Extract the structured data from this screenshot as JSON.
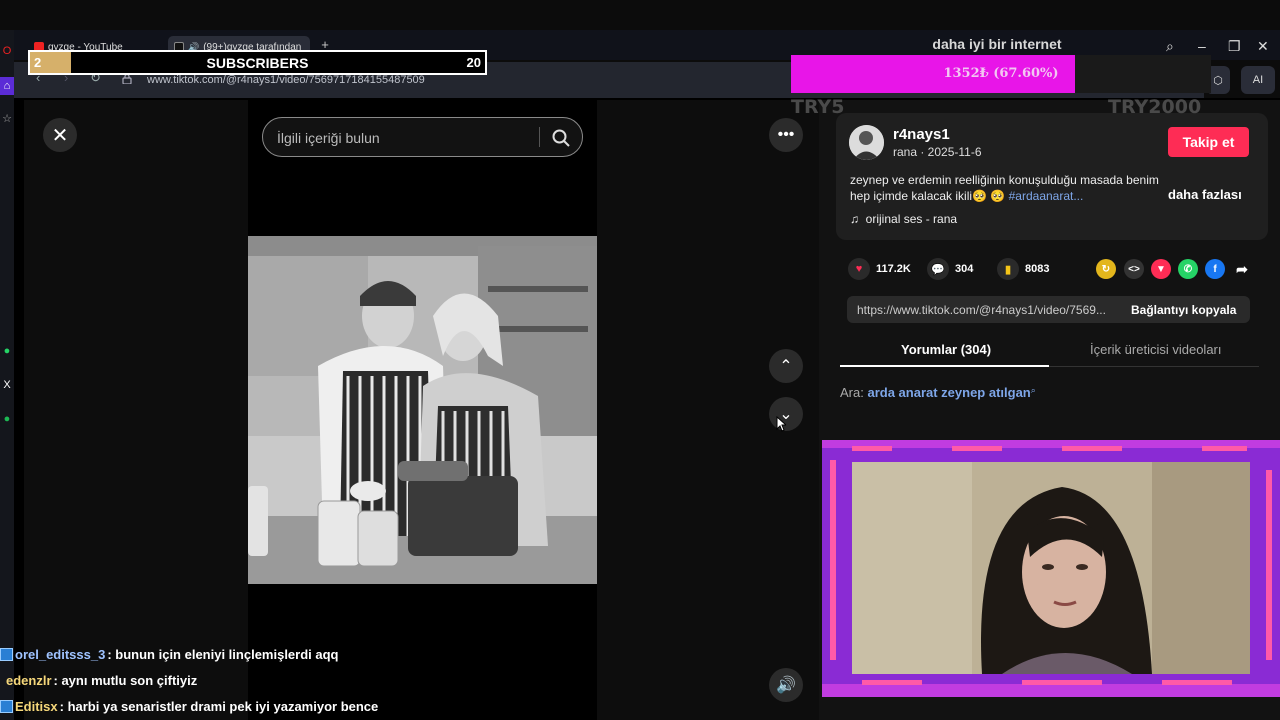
{
  "browser": {
    "tabs": [
      {
        "label": "gyzge - YouTube",
        "favicon": "youtube-icon"
      },
      {
        "label": "(99+)gyzge tarafından",
        "favicon": "tiktok-icon"
      }
    ],
    "url": "www.tiktok.com/@r4nays1/video/7569717184155487509",
    "ai_button": "AI"
  },
  "overlays": {
    "subscribers": {
      "current": "2",
      "title": "SUBSCRIBERS",
      "goal": "20",
      "progress": 0.09
    },
    "donation": {
      "title": "daha iyi bir internet",
      "text": "1352₺ (67.60%)",
      "progress": 0.676,
      "min_label": "TRY5",
      "max_label": "TRY2000"
    }
  },
  "tiktok": {
    "search_placeholder": "İlgili içeriği bulun",
    "author": {
      "username": "r4nays1",
      "subline": "rana · 2025-11-6"
    },
    "follow_label": "Takip et",
    "description_line1": "zeynep ve erdemin reelliğinin konuşulduğu masada benim",
    "description_line2": "hep içimde kalacak ikili🥺 🥺",
    "hashtag": "#ardaanarat...",
    "more_label": "daha fazlası",
    "sound": "orijinal ses - rana",
    "stats": {
      "likes": "117.2K",
      "comments": "304",
      "saves": "8083"
    },
    "link_url": "https://www.tiktok.com/@r4nays1/video/7569...",
    "copy_link_label": "Bağlantıyı kopyala",
    "tabs": {
      "comments": "Yorumlar (304)",
      "creator_videos": "İçerik üreticisi videoları"
    },
    "related_prefix": "Ara:",
    "related_query": "arda anarat zeynep atılgan"
  },
  "chat": [
    {
      "user": "orel_editsss_3",
      "message": ": bunun için eleniyi linçlemişlerdi aqq",
      "color": "#9fc3ff",
      "badge": true
    },
    {
      "user": "edenzlr",
      "message": ": aynı mutlu son çiftiyiz",
      "color": "#f5d77a",
      "badge": false
    },
    {
      "user": "Editisx",
      "message": ": harbi ya senaristler drami pek iyi yazamiyor bence",
      "color": "#f5d77a",
      "badge": true
    }
  ],
  "colors": {
    "follow": "#fe2c55",
    "donation_fill": "#e815e8",
    "subs_fill": "#d6b06a",
    "cam_frame": "#8a2bd4"
  }
}
